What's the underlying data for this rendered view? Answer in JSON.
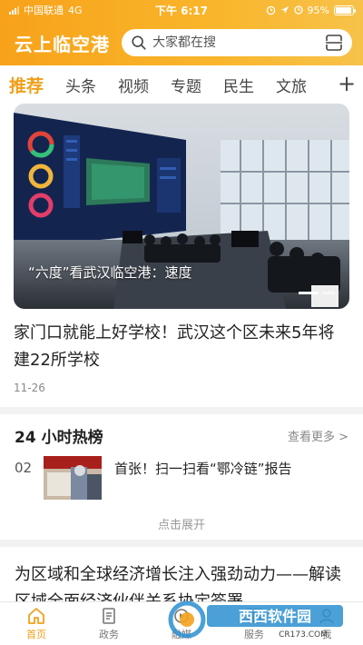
{
  "statusbar": {
    "carrier": "中国联通",
    "network": "4G",
    "time": "下午 6:17",
    "battery": "95%",
    "battery_level": 0.95
  },
  "app": {
    "title": "云上临空港"
  },
  "search": {
    "placeholder": "大家都在搜"
  },
  "tabs": [
    {
      "label": "推荐",
      "active": true
    },
    {
      "label": "头条"
    },
    {
      "label": "视频"
    },
    {
      "label": "专题"
    },
    {
      "label": "民生"
    },
    {
      "label": "文旅"
    }
  ],
  "plus_label": "+",
  "hero": {
    "caption": "“六度”看武汉临空港：速度"
  },
  "headline": {
    "title": "家门口就能上好学校！武汉这个区未来5年将建22所学校",
    "date": "11-26"
  },
  "hot": {
    "title": "24 小时热榜",
    "more": "查看更多 >",
    "items": [
      {
        "rank": "02",
        "text": "首张！扫一扫看“鄂冷链”报告"
      }
    ],
    "expand": "点击展开"
  },
  "article2": {
    "title": "为区域和全球经济增长注入强劲动力——解读区域全面经济伙伴关系协定签署"
  },
  "bottom_nav": [
    {
      "label": "首页",
      "icon": "home-icon",
      "active": true
    },
    {
      "label": "政务",
      "icon": "document-icon"
    },
    {
      "label": "融媒",
      "icon": "media-icon"
    },
    {
      "label": "服务",
      "icon": "service-icon"
    },
    {
      "label": "我",
      "icon": "user-icon"
    }
  ],
  "watermark": {
    "brand": "西西软件园",
    "site": "CR173.COM"
  },
  "colors": {
    "accent": "#f0a01a",
    "header_start": "#f7a21a",
    "header_end": "#f7c24a"
  }
}
